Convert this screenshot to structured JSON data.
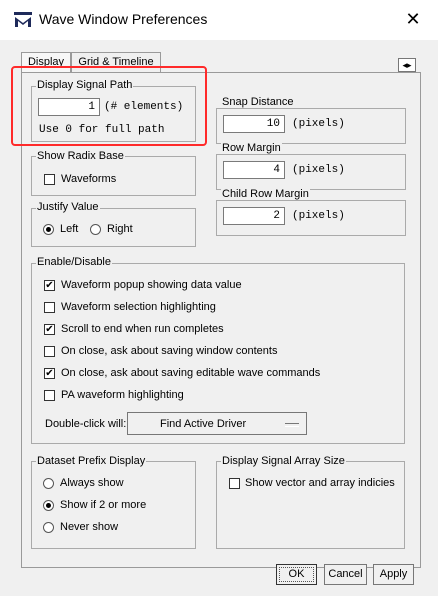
{
  "window": {
    "title": "Wave Window Preferences",
    "close": "✕"
  },
  "tabs": [
    {
      "label": "Display",
      "active": true
    },
    {
      "label": "Grid & Timeline",
      "active": false
    }
  ],
  "tab_scroll": "◂▸",
  "display_signal_path": {
    "label": "Display Signal Path",
    "value": "1",
    "unit": "(# elements)",
    "hint": "Use 0 for full path"
  },
  "show_radix_base": {
    "label": "Show Radix Base",
    "waveforms": "Waveforms",
    "waveforms_checked": false
  },
  "justify_value": {
    "label": "Justify Value",
    "left": "Left",
    "right": "Right",
    "selected": "Left"
  },
  "snap_distance": {
    "label": "Snap Distance",
    "value": "10",
    "unit": "(pixels)"
  },
  "row_margin": {
    "label": "Row Margin",
    "value": "4",
    "unit": "(pixels)"
  },
  "child_row_margin": {
    "label": "Child Row Margin",
    "value": "2",
    "unit": "(pixels)"
  },
  "enable_disable": {
    "label": "Enable/Disable",
    "items": [
      {
        "label": "Waveform popup showing data value",
        "checked": true
      },
      {
        "label": "Waveform selection highlighting",
        "checked": false
      },
      {
        "label": "Scroll to end when run completes",
        "checked": true
      },
      {
        "label": "On close, ask about saving window contents",
        "checked": false
      },
      {
        "label": "On close, ask about saving editable wave commands",
        "checked": true
      },
      {
        "label": "PA waveform highlighting",
        "checked": false
      }
    ],
    "double_click_label": "Double-click will:",
    "double_click_value": "Find Active Driver"
  },
  "dataset_prefix": {
    "label": "Dataset Prefix Display",
    "options": [
      {
        "label": "Always show",
        "selected": false
      },
      {
        "label": "Show if 2 or more",
        "selected": true
      },
      {
        "label": "Never show",
        "selected": false
      }
    ]
  },
  "signal_array_size": {
    "label": "Display Signal Array Size",
    "show_vector": "Show vector and array indicies",
    "checked": false
  },
  "buttons": {
    "ok": "OK",
    "cancel": "Cancel",
    "apply": "Apply"
  },
  "colors": {
    "highlight": "#ff2a2a",
    "logo": "#1e2a5a"
  }
}
